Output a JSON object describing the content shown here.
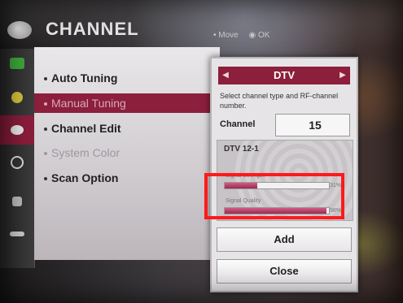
{
  "header": {
    "title": "CHANNEL"
  },
  "hints": {
    "move": "• Move",
    "ok": "◉ OK"
  },
  "menu": {
    "items": [
      {
        "label": "Auto Tuning"
      },
      {
        "label": "Manual Tuning"
      },
      {
        "label": "Channel Edit"
      },
      {
        "label": "System Color"
      },
      {
        "label": "Scan Option"
      }
    ]
  },
  "dialog": {
    "type_value": "DTV",
    "instruction": "Select channel type and RF-channel number.",
    "channel_label": "Channel",
    "channel_value": "15",
    "channel_name": "DTV 12-1",
    "signal_strength": {
      "label": "Signal Strength",
      "percent_text": "31%",
      "fraction": 0.31
    },
    "signal_quality": {
      "label": "Signal Quality",
      "percent_text": "98%",
      "fraction": 0.98
    },
    "add_label": "Add",
    "close_label": "Close"
  },
  "colors": {
    "accent": "#8b1f3c",
    "highlight_box": "#ff1a1a"
  },
  "icons": [
    "picture-icon",
    "audio-icon",
    "channel-icon",
    "time-icon",
    "lock-icon",
    "option-icon"
  ]
}
